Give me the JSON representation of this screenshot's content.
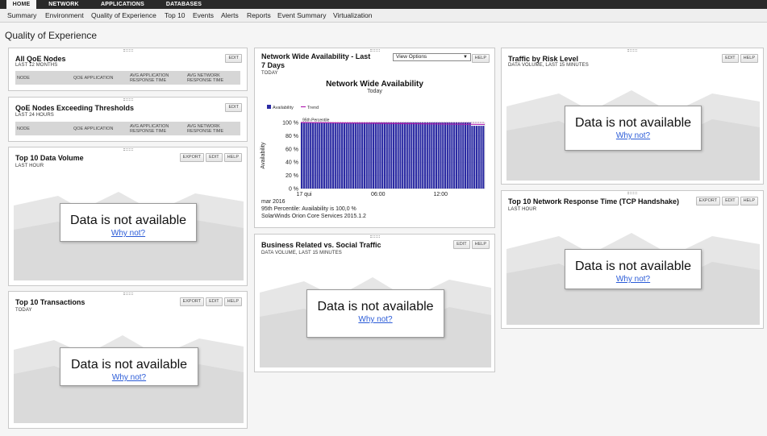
{
  "top_tabs": [
    "HOME",
    "NETWORK",
    "APPLICATIONS",
    "DATABASES"
  ],
  "sub_nav": [
    "Summary",
    "Environment",
    "Quality of Experience",
    "Top 10",
    "Events",
    "Alerts",
    "Reports",
    "Event Summary",
    "Virtualization"
  ],
  "page_title": "Quality of Experience",
  "buttons": {
    "edit": "EDIT",
    "help": "HELP",
    "export": "EXPORT"
  },
  "not_available": {
    "text": "Data is not available",
    "link": "Why not?"
  },
  "panels": {
    "all_qoe": {
      "title": "All QoE Nodes",
      "subtitle": "LAST 12 MONTHS",
      "columns": [
        "NODE",
        "QOE APPLICATION",
        "AVG APPLICATION RESPONSE TIME",
        "AVG NETWORK RESPONSE TIME"
      ]
    },
    "qoe_exceeding": {
      "title": "QoE Nodes Exceeding Thresholds",
      "subtitle": "LAST 24 HOURS",
      "columns": [
        "NODE",
        "QOE APPLICATION",
        "AVG APPLICATION RESPONSE TIME",
        "AVG NETWORK RESPONSE TIME"
      ]
    },
    "top10_volume": {
      "title": "Top 10 Data Volume",
      "subtitle": "LAST HOUR"
    },
    "top10_transactions": {
      "title": "Top 10 Transactions",
      "subtitle": "TODAY"
    },
    "availability": {
      "title": "Network Wide Availability - Last 7 Days",
      "subtitle": "TODAY",
      "view_options": "View Options",
      "footer": [
        "mar 2016",
        "95th Percentile: Availability is 100,0 %",
        "SolarWinds Orion Core Services 2015.1.2"
      ]
    },
    "business_social": {
      "title": "Business Related vs. Social Traffic",
      "subtitle": "DATA VOLUME, LAST 15 MINUTES"
    },
    "traffic_risk": {
      "title": "Traffic by Risk Level",
      "subtitle": "DATA VOLUME, LAST 15 MINUTES"
    },
    "tcp_handshake": {
      "title": "Top 10 Network Response Time (TCP Handshake)",
      "subtitle": "LAST HOUR"
    }
  },
  "chart_data": {
    "type": "bar",
    "title": "Network Wide Availability",
    "subtitle": "Today",
    "ylabel": "Availability",
    "ylim": [
      0,
      100
    ],
    "y_ticks": [
      "0 %",
      "20 %",
      "40 %",
      "60 %",
      "80 %",
      "100 %"
    ],
    "x_ticks": [
      "17 qui",
      "06:00",
      "12:00"
    ],
    "legend": [
      "Availability",
      "Trend"
    ],
    "percentile_label": "95th Percentile",
    "series": [
      {
        "name": "Availability",
        "color": "#2b2ba3",
        "values": [
          100,
          100,
          100,
          100,
          100,
          100,
          100,
          100,
          100,
          100,
          100,
          100,
          100,
          100,
          100,
          100,
          100,
          100,
          100,
          100,
          100,
          100,
          100,
          100,
          100,
          100,
          100,
          100,
          100,
          100,
          100,
          100,
          100,
          100,
          100,
          100,
          100,
          100,
          100,
          100,
          100,
          100,
          100,
          100,
          100,
          100,
          100,
          100,
          100,
          100,
          100,
          100,
          100,
          100,
          100,
          100,
          100,
          100,
          100,
          100,
          100,
          100,
          100,
          100,
          100,
          100,
          100,
          100,
          100,
          100,
          100,
          100,
          100,
          100,
          100,
          100,
          95,
          95,
          95,
          95,
          95,
          95
        ]
      },
      {
        "name": "Trend",
        "color": "#b020b0",
        "values": [
          100,
          97
        ]
      }
    ]
  }
}
